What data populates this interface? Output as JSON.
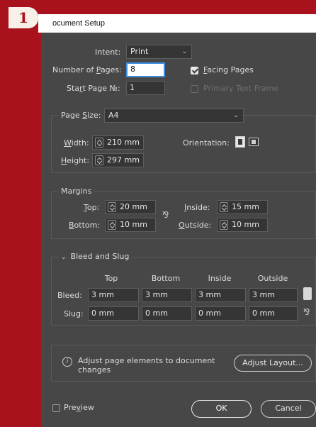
{
  "step_number": "1",
  "title": "ocument Setup",
  "intent": {
    "label": "Intent:",
    "value": "Print"
  },
  "pages": {
    "label_prefix": "Number of ",
    "label_underline": "P",
    "label_suffix": "ages:",
    "value": "8"
  },
  "facing_pages": {
    "label_underline": "F",
    "label_rest": "acing Pages",
    "checked": true
  },
  "start_page": {
    "label_prefix": "Sta",
    "label_underline": "r",
    "label_suffix": "t Page №:",
    "value": "1"
  },
  "primary_text_frame": {
    "label": "Primary Text Frame"
  },
  "page_size": {
    "label_prefix": "Page ",
    "label_underline": "S",
    "label_suffix": "ize:",
    "value": "A4"
  },
  "width": {
    "label_underline": "W",
    "label_rest": "idth:",
    "value": "210 mm"
  },
  "height": {
    "label_underline": "H",
    "label_rest": "eight:",
    "value": "297 mm"
  },
  "orientation": {
    "label": "Orientation:"
  },
  "margins": {
    "title": "Margins",
    "top": {
      "label_underline": "T",
      "label_rest": "op:",
      "value": "20 mm"
    },
    "bottom": {
      "label_underline": "B",
      "label_rest": "ottom:",
      "value": "10 mm"
    },
    "inside": {
      "label_underline": "I",
      "label_rest": "nside:",
      "value": "15 mm"
    },
    "outside": {
      "label_underline": "O",
      "label_rest": "utside:",
      "value": "10 mm"
    }
  },
  "bleed_slug": {
    "title": "Bleed and Slug",
    "columns": [
      "Top",
      "Bottom",
      "Inside",
      "Outside"
    ],
    "bleed": {
      "label": "Bleed:",
      "values": [
        "3 mm",
        "3 mm",
        "3 mm",
        "3 mm"
      ]
    },
    "slug": {
      "label": "Slug:",
      "values": [
        "0 mm",
        "0 mm",
        "0 mm",
        "0 mm"
      ]
    }
  },
  "info": {
    "text_line1": "Adjust page elements to document",
    "text_line2": "changes",
    "button": "Adjust Layout..."
  },
  "preview": {
    "label_prefix": "Pre",
    "label_underline": "v",
    "label_suffix": "iew"
  },
  "ok_label": "OK",
  "cancel_label": "Cancel",
  "colors": {
    "background": "#a8121d",
    "dialog": "#474747",
    "focus": "#3f8fe4"
  },
  "icons": [
    "chevron-down-icon",
    "info-icon",
    "chain-link-icon",
    "portrait-icon",
    "landscape-icon"
  ]
}
